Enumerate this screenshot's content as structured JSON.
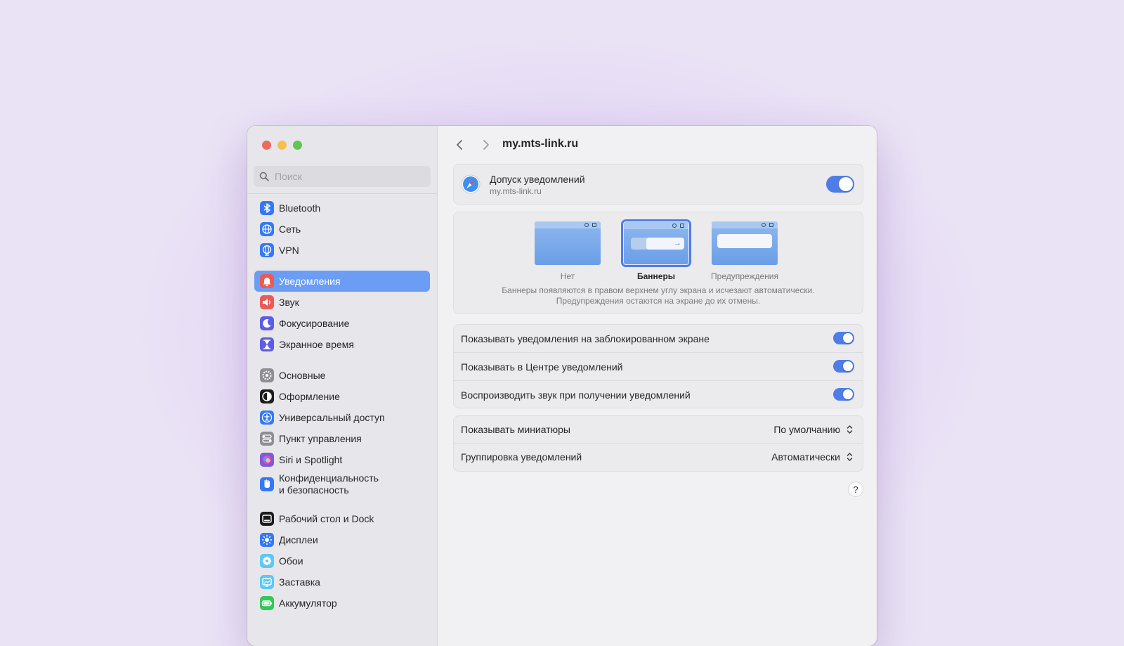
{
  "search": {
    "placeholder": "Поиск"
  },
  "sidebar": {
    "groups": [
      [
        {
          "label": "Bluetooth",
          "icon": "bluetooth-icon",
          "color": "#3478f6"
        },
        {
          "label": "Сеть",
          "icon": "globe-icon",
          "color": "#3478f6"
        },
        {
          "label": "VPN",
          "icon": "vpn-globe-icon",
          "color": "#3478f6"
        }
      ],
      [
        {
          "label": "Уведомления",
          "icon": "bell-icon",
          "color": "#ec5a56",
          "active": true
        },
        {
          "label": "Звук",
          "icon": "speaker-icon",
          "color": "#ec5a56"
        },
        {
          "label": "Фокусирование",
          "icon": "moon-icon",
          "color": "#5e5ce6"
        },
        {
          "label": "Экранное время",
          "icon": "hourglass-icon",
          "color": "#5e5ce6"
        }
      ],
      [
        {
          "label": "Основные",
          "icon": "gear-icon",
          "color": "#8e8e93"
        },
        {
          "label": "Оформление",
          "icon": "appearance-icon",
          "color": "#1c1c1e"
        },
        {
          "label": "Универсальный доступ",
          "icon": "accessibility-icon",
          "color": "#3478f6"
        },
        {
          "label": "Пункт управления",
          "icon": "control-center-icon",
          "color": "#8e8e93"
        },
        {
          "label": "Siri и Spotlight",
          "icon": "siri-icon",
          "color": "#7f5ad8"
        },
        {
          "label": "Конфиденциальность\nи безопасность",
          "icon": "hand-icon",
          "color": "#3478f6",
          "twoLine": true
        }
      ],
      [
        {
          "label": "Рабочий стол и Dock",
          "icon": "dock-icon",
          "color": "#1c1c1e"
        },
        {
          "label": "Дисплеи",
          "icon": "sun-icon",
          "color": "#3478f6"
        },
        {
          "label": "Обои",
          "icon": "flower-icon",
          "color": "#5ac8fa"
        },
        {
          "label": "Заставка",
          "icon": "screensaver-icon",
          "color": "#5ac8fa"
        },
        {
          "label": "Аккумулятор",
          "icon": "battery-icon",
          "color": "#34c759"
        }
      ]
    ]
  },
  "header": {
    "title": "my.mts-link.ru"
  },
  "permission": {
    "title": "Допуск уведомлений",
    "subtitle": "my.mts-link.ru",
    "enabled": true
  },
  "alert_style": {
    "options": [
      {
        "label": "Нет",
        "selected": false
      },
      {
        "label": "Баннеры",
        "selected": true
      },
      {
        "label": "Предупреждения",
        "selected": false
      }
    ],
    "description_line1": "Баннеры появляются в правом верхнем углу экрана и исчезают автоматически.",
    "description_line2": "Предупреждения остаются на экране до их отмены."
  },
  "toggles": [
    {
      "label": "Показывать уведомления на заблокированном экране",
      "enabled": true
    },
    {
      "label": "Показывать в Центре уведомлений",
      "enabled": true
    },
    {
      "label": "Воспроизводить звук при получении уведомлений",
      "enabled": true
    }
  ],
  "selects": [
    {
      "label": "Показывать миниатюры",
      "value": "По умолчанию"
    },
    {
      "label": "Группировка уведомлений",
      "value": "Автоматически"
    }
  ],
  "help": {
    "label": "?"
  },
  "colors": {
    "accent": "#4f7de8",
    "sidebar_active": "#6b9df5"
  }
}
